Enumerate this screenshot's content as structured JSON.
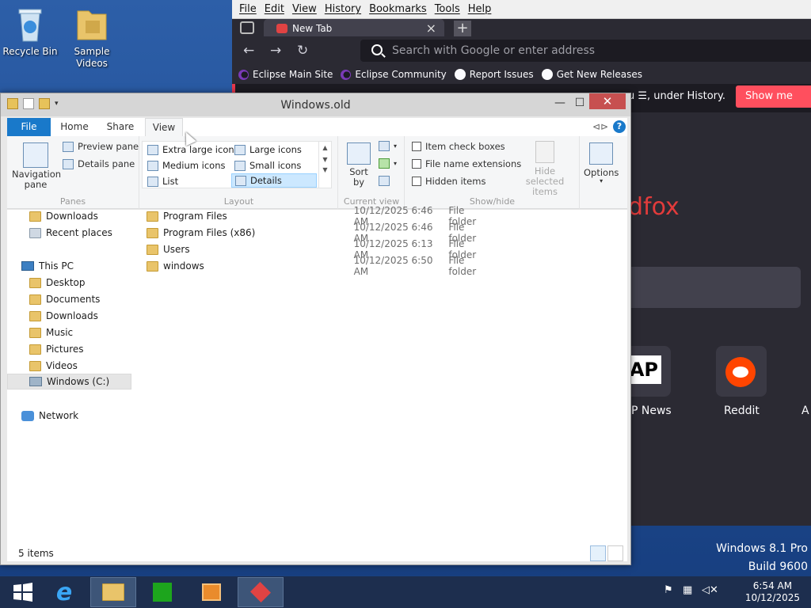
{
  "desktop": {
    "icons": [
      {
        "label": "Recycle Bin"
      },
      {
        "label": "Sample Videos"
      }
    ],
    "watermark": {
      "line1": "Windows 8.1 Pro",
      "line2": "Build 9600"
    }
  },
  "browser": {
    "menu": [
      "File",
      "Edit",
      "View",
      "History",
      "Bookmarks",
      "Tools",
      "Help"
    ],
    "tab_title": "New Tab",
    "tab_close": "×",
    "newtab": "+",
    "url_placeholder": "Search with Google or enter address",
    "bookmarks": [
      "Eclipse Main Site",
      "Eclipse Community",
      "Report Issues",
      "Get New Releases"
    ],
    "notice_text": "enu ☰, under History.",
    "notice_button": "Show me how",
    "brand_partial": "dfox",
    "shortcuts": [
      {
        "label": "P News",
        "icon_text": "AP"
      },
      {
        "label": "Reddit"
      },
      {
        "label": "A"
      }
    ]
  },
  "explorer": {
    "title": "Windows.old",
    "ribbon_tabs": [
      "File",
      "Home",
      "Share",
      "View"
    ],
    "active_tab": "View",
    "panes": {
      "label": "Panes",
      "navigation_pane": "Navigation pane",
      "preview_pane": "Preview pane",
      "details_pane": "Details pane"
    },
    "layout": {
      "label": "Layout",
      "options": [
        "Extra large icons",
        "Large icons",
        "Medium icons",
        "Small icons",
        "List",
        "Details"
      ],
      "selected": "Details"
    },
    "current_view": {
      "label": "Current view",
      "sort_by": "Sort by"
    },
    "show_hide": {
      "label": "Show/hide",
      "item_check_boxes": "Item check boxes",
      "file_name_extensions": "File name extensions",
      "hidden_items": "Hidden items",
      "hide_selected_items": "Hide selected items"
    },
    "options_label": "Options",
    "help": "?",
    "nav": [
      {
        "label": "Downloads",
        "icon": "download-folder-icon"
      },
      {
        "label": "Recent places",
        "icon": "recent-places-icon"
      },
      {
        "label": "This PC",
        "icon": "pc-icon"
      },
      {
        "label": "Desktop",
        "icon": "folder-icon"
      },
      {
        "label": "Documents",
        "icon": "folder-icon"
      },
      {
        "label": "Downloads",
        "icon": "folder-icon"
      },
      {
        "label": "Music",
        "icon": "folder-icon"
      },
      {
        "label": "Pictures",
        "icon": "folder-icon"
      },
      {
        "label": "Videos",
        "icon": "folder-icon"
      },
      {
        "label": "Windows (C:)",
        "icon": "drive-icon"
      },
      {
        "label": "Network",
        "icon": "network-icon"
      }
    ],
    "selected_nav": "Windows (C:)",
    "files": [
      {
        "name": "Program Files",
        "date": "10/12/2025 6:46 AM",
        "type": "File folder"
      },
      {
        "name": "Program Files (x86)",
        "date": "10/12/2025 6:46 AM",
        "type": "File folder"
      },
      {
        "name": "Users",
        "date": "10/12/2025 6:13 AM",
        "type": "File folder"
      },
      {
        "name": "windows",
        "date": "10/12/2025 6:50 AM",
        "type": "File folder"
      }
    ],
    "status": "5 items"
  },
  "taskbar": {
    "time": "6:54 AM",
    "date": "10/12/2025"
  },
  "colors": {
    "file_tab": "#1979ca",
    "close_button": "#c75050",
    "notice_button": "#ff4f5e",
    "selection": "#cce8ff"
  }
}
